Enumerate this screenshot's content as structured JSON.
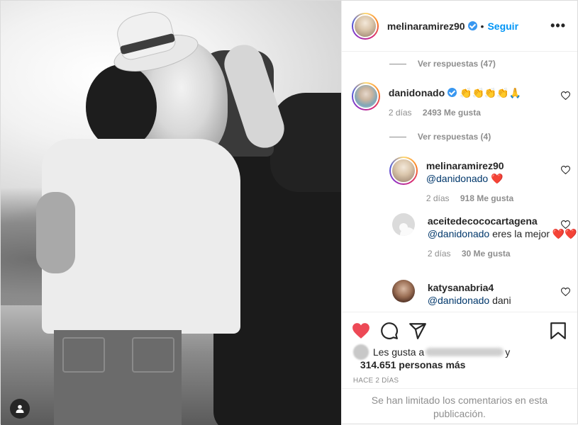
{
  "post": {
    "author": "melinaramirez90",
    "follow_label": "Seguir",
    "more_label": "•••"
  },
  "comments": {
    "view_replies_top": "Ver respuestas (47)",
    "items": [
      {
        "username": "danidonado",
        "verified": true,
        "text": "👏👏👏👏🙏",
        "time": "2 días",
        "likes": "2493 Me gusta"
      }
    ],
    "view_replies_mid": "Ver respuestas (4)",
    "replies": [
      {
        "username": "melinaramirez90",
        "mention": "@danidonado",
        "text": " ❤️",
        "time": "2 días",
        "likes": "918 Me gusta"
      },
      {
        "username": "aceitedecococartagena",
        "mention": "@danidonado",
        "text": " eres la mejor ❤️❤️",
        "time": "2 días",
        "likes": "30 Me gusta"
      },
      {
        "username": "katysanabria4",
        "mention": "@danidonado",
        "text": " dani"
      }
    ]
  },
  "likes": {
    "prefix": "Les gusta a",
    "suffix": "y",
    "count": "314.651 personas más"
  },
  "timestamp": "HACE 2 DÍAS",
  "comments_limited": "Se han limitado los comentarios en esta publicación.",
  "colors": {
    "link": "#0095f6",
    "heart": "#ed4956",
    "verified": "#3897f0",
    "muted": "#8e8e8e"
  },
  "icons": [
    "heart-icon",
    "comment-icon",
    "share-icon",
    "bookmark-icon",
    "user-tag-icon",
    "verified-icon",
    "more-icon"
  ]
}
